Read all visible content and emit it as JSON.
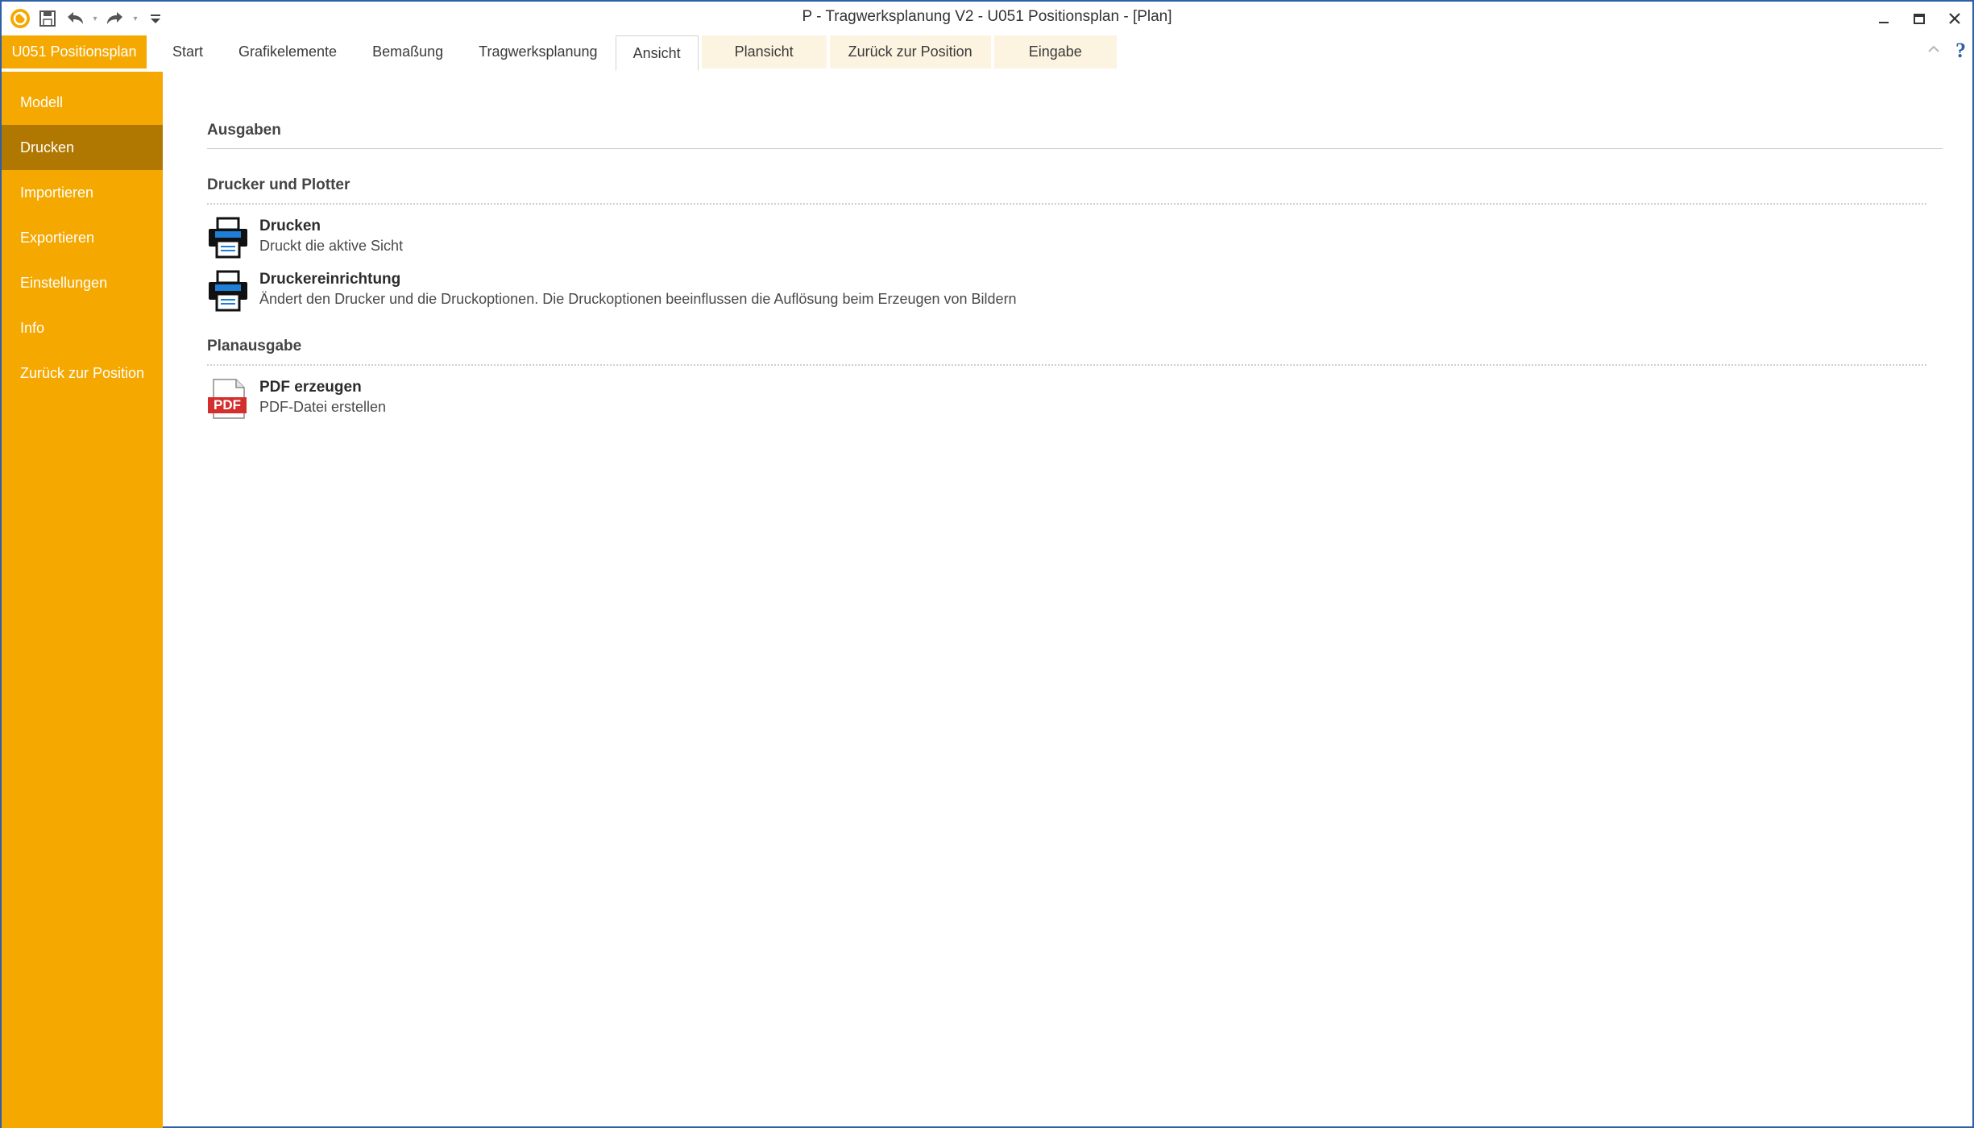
{
  "window": {
    "title": "P - Tragwerksplanung V2 - U051 Positionsplan - [Plan]"
  },
  "ribbon": {
    "app_tab": "U051 Positionsplan",
    "tabs": [
      {
        "label": "Start"
      },
      {
        "label": "Grafikelemente"
      },
      {
        "label": "Bemaßung"
      },
      {
        "label": "Tragwerksplanung"
      },
      {
        "label": "Ansicht"
      },
      {
        "label": "Plansicht"
      },
      {
        "label": "Zurück zur Position"
      },
      {
        "label": "Eingabe"
      }
    ],
    "help_label": "?"
  },
  "sidebar": {
    "items": [
      {
        "label": "Modell"
      },
      {
        "label": "Drucken"
      },
      {
        "label": "Importieren"
      },
      {
        "label": "Exportieren"
      },
      {
        "label": "Einstellungen"
      },
      {
        "label": "Info"
      },
      {
        "label": "Zurück zur Position"
      }
    ],
    "selected": "Drucken"
  },
  "main": {
    "heading": "Ausgaben",
    "groups": [
      {
        "title": "Drucker und Plotter",
        "commands": [
          {
            "title": "Drucken",
            "description": "Druckt die aktive Sicht",
            "icon": "printer-icon"
          },
          {
            "title": "Druckereinrichtung",
            "description": "Ändert den Drucker und die Druckoptionen. Die Druckoptionen beeinflussen die Auflösung beim Erzeugen von Bildern",
            "icon": "printer-setup-icon"
          }
        ]
      },
      {
        "title": "Planausgabe",
        "commands": [
          {
            "title": "PDF erzeugen",
            "description": "PDF-Datei erstellen",
            "icon": "pdf-icon",
            "icon_text": "PDF"
          }
        ]
      }
    ]
  },
  "colors": {
    "accent": "#f5a800",
    "selected": "#b07800",
    "window_border": "#2f5fa8"
  }
}
